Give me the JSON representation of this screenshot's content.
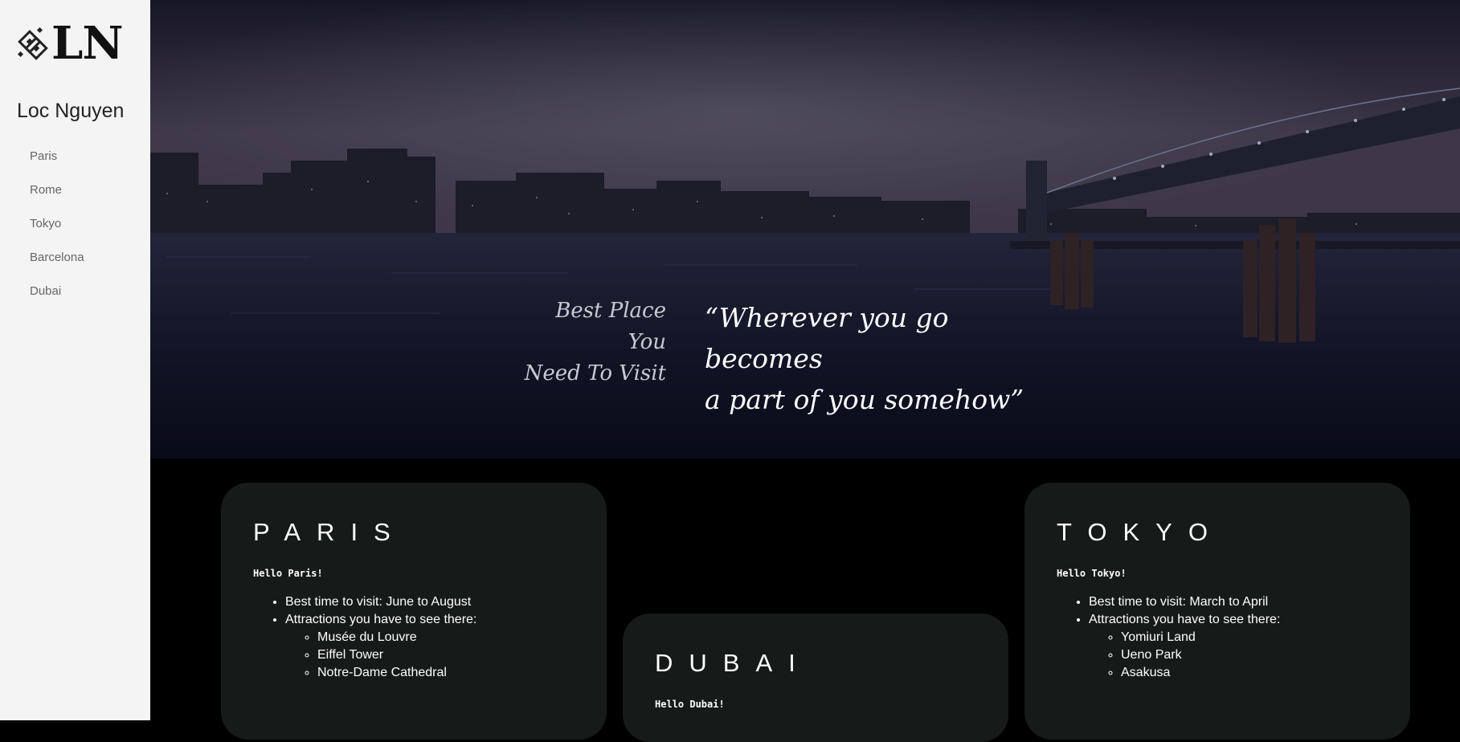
{
  "sidebar": {
    "logo_text": "LN",
    "site_name": "Loc Nguyen",
    "nav": [
      "Paris",
      "Rome",
      "Tokyo",
      "Barcelona",
      "Dubai"
    ]
  },
  "hero": {
    "tagline": [
      "Best Place",
      "You",
      "Need To Visit"
    ],
    "quote": [
      "“Wherever you go",
      "becomes",
      "a part of you somehow”"
    ]
  },
  "cards": {
    "paris": {
      "title": "PARIS",
      "hello": "Hello Paris!",
      "best_time": "Best time to visit: June to August",
      "attractions_label": "Attractions you have to see there:",
      "attractions": [
        "Musée du Louvre",
        "Eiffel Tower",
        "Notre-Dame Cathedral"
      ]
    },
    "dubai": {
      "title": "DUBAI",
      "hello": "Hello Dubai!"
    },
    "tokyo": {
      "title": "TOKYO",
      "hello": "Hello Tokyo!",
      "best_time": "Best time to visit: March to April",
      "attractions_label": "Attractions you have to see there:",
      "attractions": [
        "Yomiuri Land",
        "Ueno Park",
        "Asakusa"
      ]
    }
  },
  "colors": {
    "sidebar_bg": "#f4f4f4",
    "page_bg": "#000000",
    "card_bg": "#161a19"
  }
}
